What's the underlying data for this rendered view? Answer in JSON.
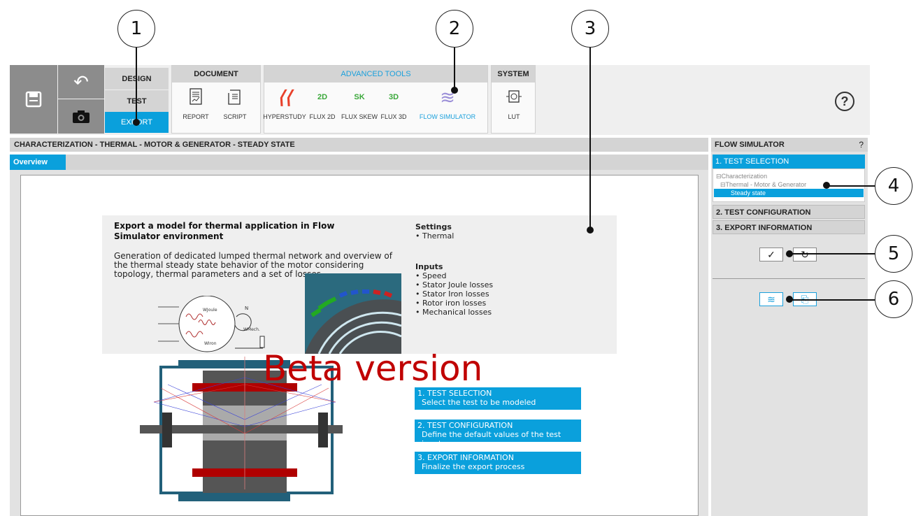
{
  "callouts": [
    "1",
    "2",
    "3",
    "4",
    "5",
    "6"
  ],
  "ribbon": {
    "modes": [
      "DESIGN",
      "TEST",
      "EXPORT"
    ],
    "active_mode": "EXPORT",
    "document": {
      "title": "DOCUMENT",
      "tools": [
        "REPORT",
        "SCRIPT"
      ]
    },
    "advanced": {
      "title": "ADVANCED TOOLS",
      "tools": [
        "HYPERSTUDY",
        "FLUX 2D",
        "FLUX SKEW",
        "FLUX 3D",
        "FLOW SIMULATOR"
      ],
      "flux_badges": [
        "2D",
        "SK",
        "3D"
      ]
    },
    "system": {
      "title": "SYSTEM",
      "tools": [
        "LUT"
      ]
    },
    "help_icon": "?"
  },
  "left_pane": {
    "header": "CHARACTERIZATION - THERMAL - MOTOR & GENERATOR - STEADY STATE",
    "tab": "Overview"
  },
  "overview": {
    "title": "Export a model for thermal application in Flow Simulator environment",
    "description": "Generation of dedicated lumped thermal network and overview of the thermal steady state behavior of the motor considering topology, thermal parameters and a set of losses",
    "settings_title": "Settings",
    "settings": [
      "• Thermal"
    ],
    "inputs_title": "Inputs",
    "inputs": [
      "• Speed",
      "• Stator Joule losses",
      "• Stator Iron losses",
      "• Rotor iron losses",
      "• Mechanical losses"
    ],
    "diagram_labels": [
      "WJoule",
      "N",
      "WMech.",
      "WIron"
    ],
    "beta": "Beta version",
    "steps": [
      {
        "title": "1. TEST SELECTION",
        "desc": "Select the test to be modeled"
      },
      {
        "title": "2. TEST CONFIGURATION",
        "desc": "Define the default values of the test inputs"
      },
      {
        "title": "3. EXPORT INFORMATION",
        "desc": "Finalize the export process"
      }
    ]
  },
  "right_pane": {
    "title": "FLOW SIMULATOR",
    "help": "?",
    "step1": "1. TEST SELECTION",
    "tree": [
      "⊟Characterization",
      "⊟Thermal - Motor & Generator",
      "Steady state"
    ],
    "step2": "2. TEST CONFIGURATION",
    "step3": "3. EXPORT INFORMATION",
    "buttons": {
      "apply_icon": "✓",
      "reset_icon": "↻",
      "flow_icon": "≋",
      "export_icon": "⎘"
    }
  },
  "colors": {
    "accent": "#0aa0dc",
    "beta": "#c00000",
    "toolbar_gray": "#8c8c8c"
  }
}
